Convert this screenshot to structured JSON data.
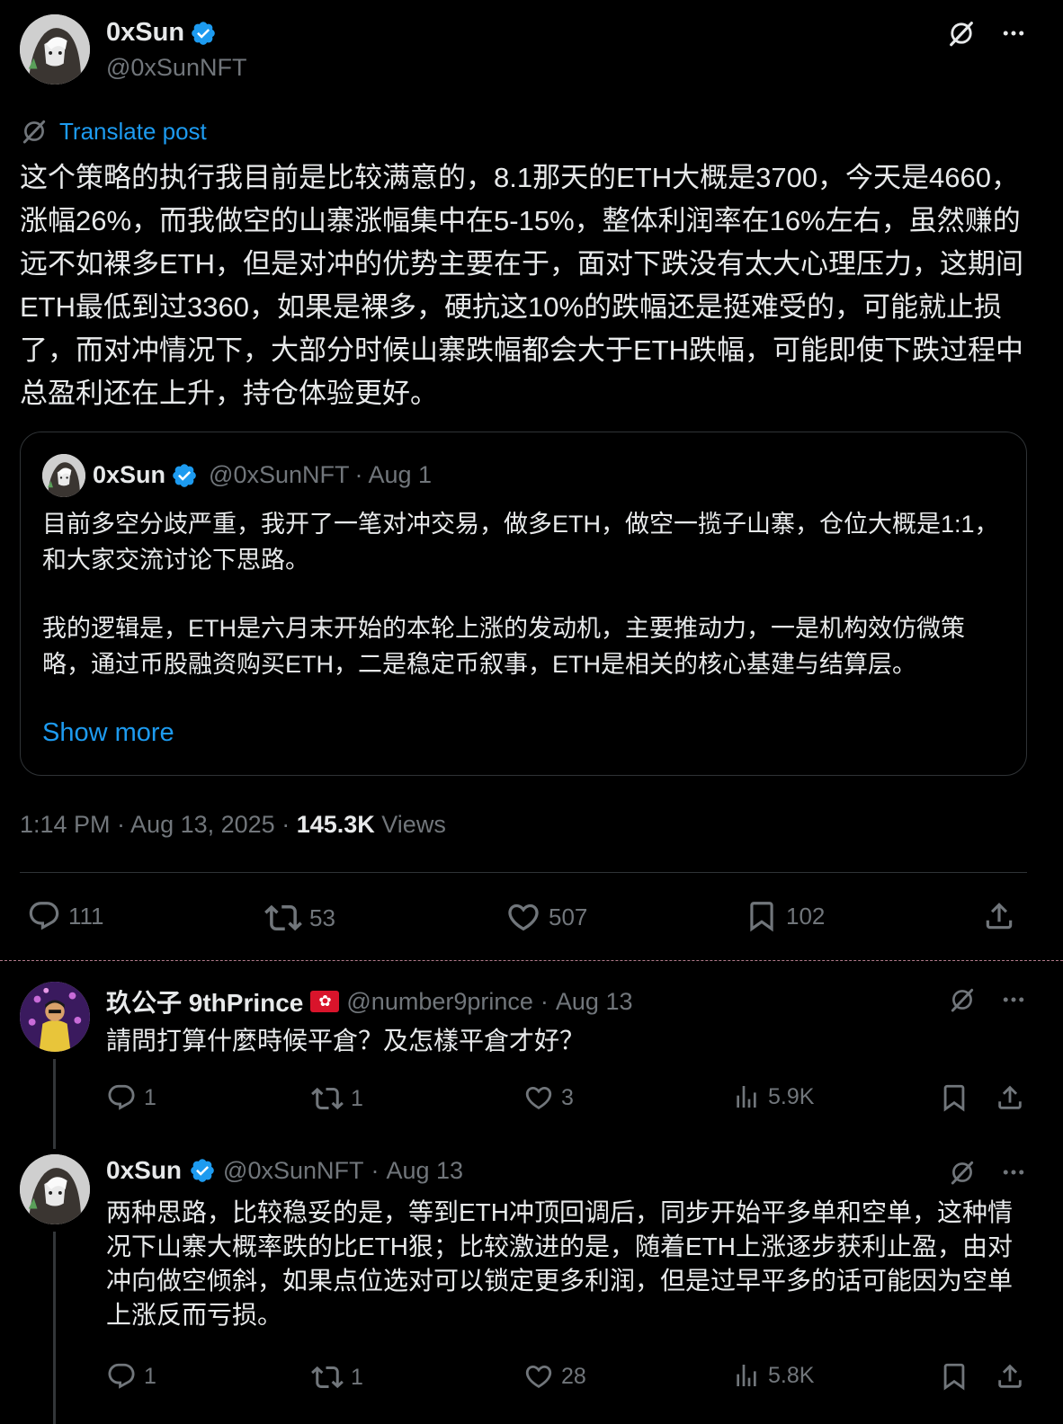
{
  "main_post": {
    "author_name": "0xSun",
    "handle": "@0xSunNFT",
    "translate_label": "Translate post",
    "body": "这个策略的执行我目前是比较满意的，8.1那天的ETH大概是3700，今天是4660，涨幅26%，而我做空的山寨涨幅集中在5-15%，整体利润率在16%左右，虽然赚的远不如裸多ETH，但是对冲的优势主要在于，面对下跌没有太大心理压力，这期间ETH最低到过3360，如果是裸多，硬抗这10%的跌幅还是挺难受的，可能就止损了，而对冲情况下，大部分时候山寨跌幅都会大于ETH跌幅，可能即使下跌过程中总盈利还在上升，持仓体验更好。",
    "quote": {
      "author_name": "0xSun",
      "handle": "@0xSunNFT",
      "date": "Aug 1",
      "para1": "目前多空分歧严重，我开了一笔对冲交易，做多ETH，做空一揽子山寨，仓位大概是1:1，和大家交流讨论下思路。",
      "para2": "我的逻辑是，ETH是六月末开始的本轮上涨的发动机，主要推动力，一是机构效仿微策略，通过币股融资购买ETH，二是稳定币叙事，ETH是相关的核心基建与结算层。",
      "show_more": "Show more"
    },
    "timestamp": "1:14 PM · Aug 13, 2025 · ",
    "views_count": "145.3K",
    "views_label": " Views",
    "stats": {
      "replies": "111",
      "reposts": "53",
      "likes": "507",
      "bookmarks": "102"
    }
  },
  "replies": [
    {
      "author_name": "玖公子 9thPrince",
      "flag": "🇭🇰",
      "handle": "@number9prince",
      "date": "Aug 13",
      "body": "請問打算什麼時候平倉？及怎樣平倉才好？",
      "stats": {
        "replies": "1",
        "reposts": "1",
        "likes": "3",
        "views": "5.9K"
      }
    },
    {
      "author_name": "0xSun",
      "handle": "@0xSunNFT",
      "date": "Aug 13",
      "body": "两种思路，比较稳妥的是，等到ETH冲顶回调后，同步开始平多单和空单，这种情况下山寨大概率跌的比ETH狠；比较激进的是，随着ETH上涨逐步获利止盈，由对冲向做空倾斜，如果点位选对可以锁定更多利润，但是过早平多的话可能因为空单上涨反而亏损。",
      "stats": {
        "replies": "1",
        "reposts": "1",
        "likes": "28",
        "views": "5.8K"
      }
    }
  ],
  "colors": {
    "background": "#000000",
    "text": "#e7e9ea",
    "muted": "#71767b",
    "accent": "#1d9bf0",
    "divider": "#2f3336"
  },
  "icons": [
    "grok-icon",
    "more-icon",
    "verified-badge-icon",
    "translate-icon",
    "reply-icon",
    "repost-icon",
    "like-icon",
    "bookmark-icon",
    "share-icon",
    "views-icon",
    "hk-flag-icon"
  ]
}
